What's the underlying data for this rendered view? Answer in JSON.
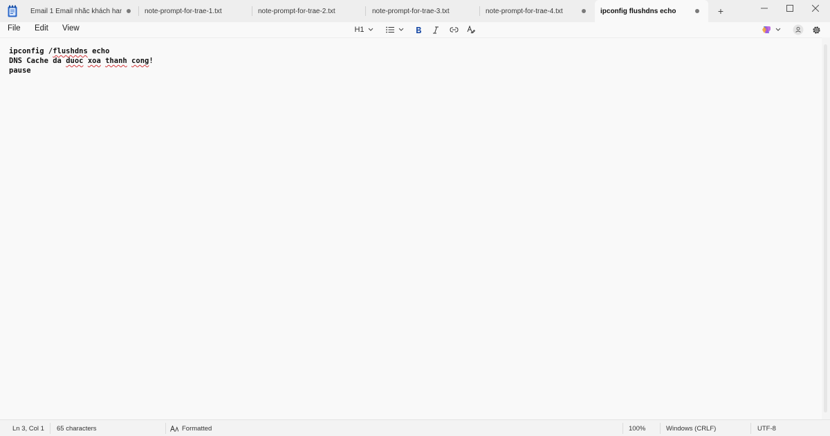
{
  "tabs": [
    {
      "label": "Email 1 Email nhắc khách hang",
      "unsaved": true,
      "active": false
    },
    {
      "label": "note-prompt-for-trae-1.txt",
      "unsaved": false,
      "active": false
    },
    {
      "label": "note-prompt-for-trae-2.txt",
      "unsaved": false,
      "active": false
    },
    {
      "label": "note-prompt-for-trae-3.txt",
      "unsaved": false,
      "active": false
    },
    {
      "label": "note-prompt-for-trae-4.txt",
      "unsaved": true,
      "active": false
    },
    {
      "label": "ipconfig flushdns echo",
      "unsaved": true,
      "active": true
    }
  ],
  "new_tab_label": "+",
  "menu": {
    "file": "File",
    "edit": "Edit",
    "view": "View"
  },
  "toolbar": {
    "heading": "H1"
  },
  "editor": {
    "lines": [
      {
        "parts": [
          {
            "t": "ipconfig /",
            "spell": false
          },
          {
            "t": "flushdns",
            "spell": true
          },
          {
            "t": " echo",
            "spell": false
          }
        ]
      },
      {
        "parts": [
          {
            "t": "DNS Cache da ",
            "spell": false
          },
          {
            "t": "duoc",
            "spell": true
          },
          {
            "t": " ",
            "spell": false
          },
          {
            "t": "xoa",
            "spell": true
          },
          {
            "t": " ",
            "spell": false
          },
          {
            "t": "thanh",
            "spell": true
          },
          {
            "t": " ",
            "spell": false
          },
          {
            "t": "cong",
            "spell": true
          },
          {
            "t": "!",
            "spell": false
          }
        ]
      },
      {
        "parts": [
          {
            "t": "pause",
            "spell": false
          }
        ]
      }
    ]
  },
  "status": {
    "position": "Ln 3, Col 1",
    "characters": "65 characters",
    "format": "Formatted",
    "zoom": "100%",
    "line_ending": "Windows (CRLF)",
    "encoding": "UTF-8"
  },
  "colors": {
    "accent": "#1f4fa8",
    "spellcheck": "#d13438",
    "copilot": "#7b4ce8"
  },
  "icons": [
    "notepad-icon",
    "chevron-down-icon",
    "list-icon",
    "bold-icon",
    "italic-icon",
    "link-icon",
    "clear-format-icon",
    "copilot-icon",
    "account-icon",
    "gear-icon",
    "minimize-icon",
    "maximize-icon",
    "close-icon",
    "format-icon"
  ]
}
